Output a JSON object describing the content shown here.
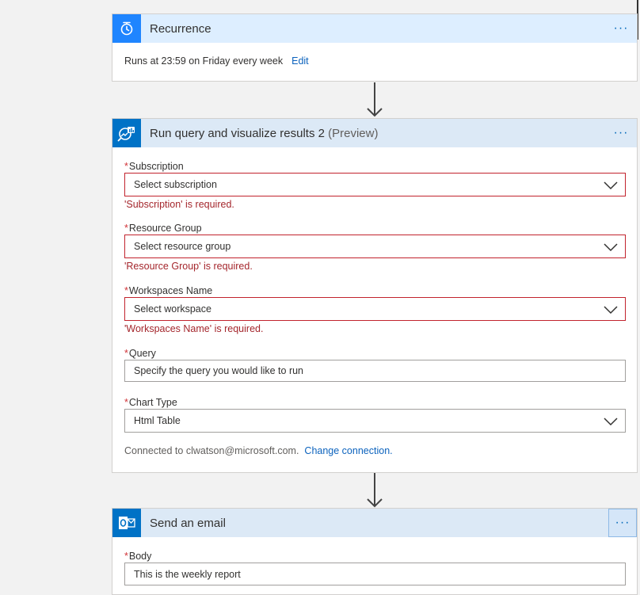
{
  "recurrence": {
    "title": "Recurrence",
    "more_label": "···",
    "runs_text": "Runs at 23:59 on Friday every week",
    "edit_label": "Edit"
  },
  "query_card": {
    "title": "Run query and visualize results 2",
    "preview_tag": "(Preview)",
    "more_label": "···",
    "required_mark": "*",
    "fields": {
      "subscription": {
        "label": "Subscription",
        "placeholder": "Select subscription",
        "error": "'Subscription' is required."
      },
      "resource_group": {
        "label": "Resource Group",
        "placeholder": "Select resource group",
        "error": "'Resource Group' is required."
      },
      "workspaces_name": {
        "label": "Workspaces Name",
        "placeholder": "Select workspace",
        "error": "'Workspaces Name' is required."
      },
      "query": {
        "label": "Query",
        "placeholder": "Specify the query you would like to run"
      },
      "chart_type": {
        "label": "Chart Type",
        "value": "Html Table"
      }
    },
    "connected_text": "Connected to clwatson@microsoft.com.",
    "change_connection_label": "Change connection."
  },
  "email_card": {
    "title": "Send an email",
    "more_label": "···",
    "required_mark": "*",
    "body_label": "Body",
    "body_value": "This is the weekly report"
  },
  "colors": {
    "accent": "#0b62bd",
    "error": "#a4262c",
    "header_bg": "#dce9f6",
    "recurrence_icon_bg": "#1f85ff",
    "loganalytics_icon_bg": "#0072c6",
    "outlook_icon_bg": "#0072c6"
  },
  "icons": {
    "recurrence": "alarm-clock-icon",
    "query": "log-analytics-icon",
    "email": "outlook-icon",
    "dropdown": "chevron-down-icon",
    "connector": "arrow-down-icon"
  }
}
